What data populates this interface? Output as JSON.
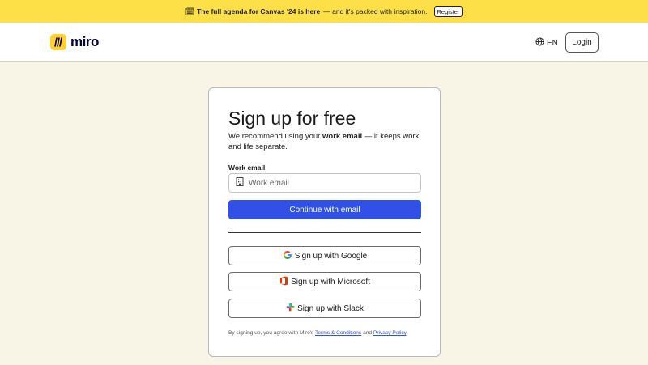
{
  "banner": {
    "highlight": "The full agenda for Canvas '24 is here",
    "rest": "— and it's packed with inspiration.",
    "register_label": "Register"
  },
  "header": {
    "logo_text": "miro",
    "language": "EN",
    "login_label": "Login"
  },
  "signup": {
    "title": "Sign up for free",
    "subtitle_pre": "We recommend using your ",
    "subtitle_bold": "work email",
    "subtitle_post": " — it keeps work and life separate.",
    "email_label": "Work email",
    "email_placeholder": "Work email",
    "email_value": "",
    "continue_label": "Continue with email",
    "google_label": "Sign up with Google",
    "microsoft_label": "Sign up with Microsoft",
    "slack_label": "Sign up with Slack",
    "legal_pre": "By signing up, you agree with Miro's ",
    "terms_label": "Terms & Conditions",
    "legal_and": " and ",
    "privacy_label": "Privacy Policy",
    "legal_post": "."
  },
  "colors": {
    "banner": "#fde047",
    "accent": "#3050e6",
    "page_bg": "#f8f4e6",
    "logo": "#ffd02f"
  },
  "icons": {
    "banner": "calendar-icon",
    "language": "globe-icon",
    "email": "building-icon",
    "google": "google-icon",
    "microsoft": "office-icon",
    "slack": "slack-icon"
  }
}
